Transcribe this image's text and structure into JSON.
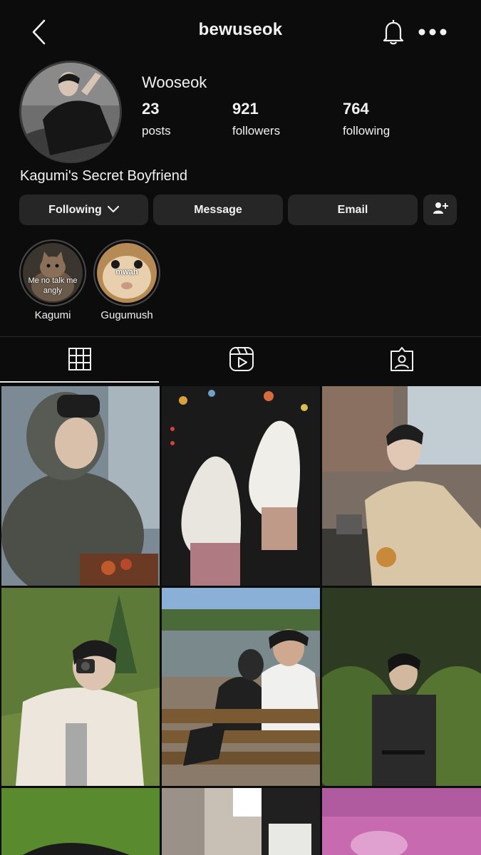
{
  "header": {
    "username": "bewuseok",
    "back_icon": "chevron-left-icon",
    "bell_icon": "bell-icon",
    "more_icon": "more-horizontal-icon"
  },
  "profile": {
    "display_name": "Wooseok",
    "posts": {
      "count": "23",
      "label": "posts"
    },
    "followers": {
      "count": "921",
      "label": "followers"
    },
    "following": {
      "count": "764",
      "label": "following"
    },
    "bio": "Kagumi's Secret Boyfriend"
  },
  "actions": {
    "following_label": "Following",
    "message_label": "Message",
    "email_label": "Email",
    "add_user_icon": "add-user-icon"
  },
  "highlights": [
    {
      "name": "Kagumi",
      "caption": "Me no talk me angly"
    },
    {
      "name": "Gugumush",
      "caption": "mwah"
    }
  ],
  "tabs": [
    "grid-icon",
    "reels-icon",
    "tagged-icon"
  ],
  "colors": {
    "background": "#0c0c0c",
    "button": "#262626",
    "text": "#f2f2f2"
  }
}
